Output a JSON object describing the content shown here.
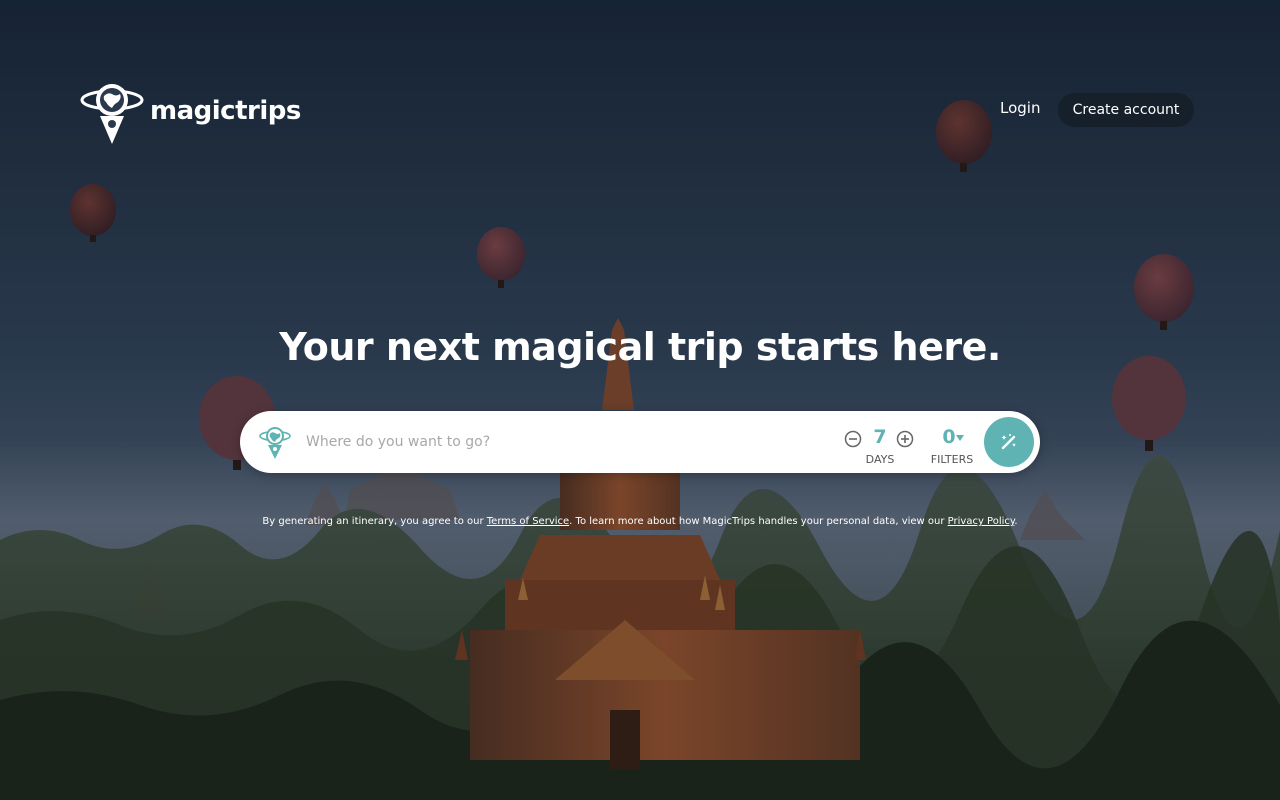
{
  "brand": {
    "name": "magictrips",
    "logo_icon": "globe-pin-logo-icon"
  },
  "nav": {
    "login_label": "Login",
    "create_account_label": "Create account"
  },
  "hero": {
    "title": "Your next magical trip starts here."
  },
  "search": {
    "placeholder": "Where do you want to go?",
    "value": "",
    "icon": "globe-pin-icon",
    "days": {
      "value": "7",
      "label": "DAYS",
      "decrement_icon": "minus-circle-icon",
      "increment_icon": "plus-circle-icon"
    },
    "filters": {
      "value": "0",
      "label": "FILTERS",
      "icon": "caret-down-icon"
    },
    "generate_icon": "magic-wand-icon"
  },
  "disclaimer": {
    "prefix": "By generating an itinerary, you agree to our ",
    "terms_label": "Terms of Service",
    "middle": ". To learn more about how MagicTrips handles your personal data, view our ",
    "privacy_label": "Privacy Policy",
    "suffix": "."
  },
  "colors": {
    "accent": "#5fb3b3",
    "button_dark": "#15202b",
    "sky_top": "#1a2838",
    "sky_bottom": "#4e5d6e"
  }
}
